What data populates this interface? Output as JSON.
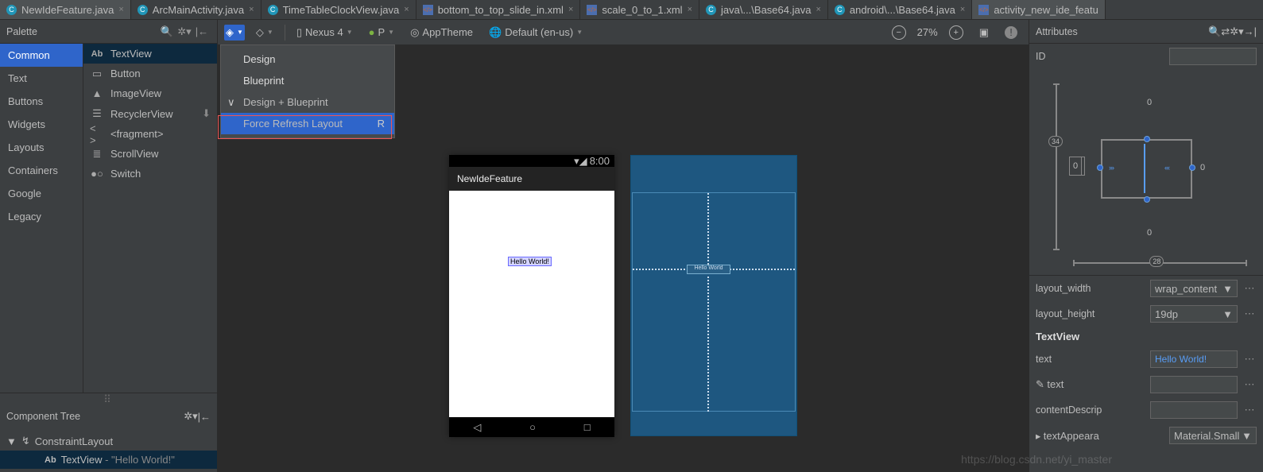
{
  "tabs": [
    {
      "label": "NewIdeFeature.java",
      "icon": "c",
      "sel": true
    },
    {
      "label": "ArcMainActivity.java",
      "icon": "c"
    },
    {
      "label": "TimeTableClockView.java",
      "icon": "c"
    },
    {
      "label": "bottom_to_top_slide_in.xml",
      "icon": "x"
    },
    {
      "label": "scale_0_to_1.xml",
      "icon": "x"
    },
    {
      "label": "java\\...\\Base64.java",
      "icon": "c"
    },
    {
      "label": "android\\...\\Base64.java",
      "icon": "c"
    },
    {
      "label": "activity_new_ide_featu",
      "icon": "x",
      "sel": true
    }
  ],
  "palette": {
    "title": "Palette",
    "categories": [
      "Common",
      "Text",
      "Buttons",
      "Widgets",
      "Layouts",
      "Containers",
      "Google",
      "Legacy"
    ],
    "items": [
      {
        "label": "TextView",
        "icon": "Ab",
        "sel": true
      },
      {
        "label": "Button",
        "icon": "▭"
      },
      {
        "label": "ImageView",
        "icon": "▲"
      },
      {
        "label": "RecyclerView",
        "icon": "≡",
        "dl": true
      },
      {
        "label": "<fragment>",
        "icon": "<>"
      },
      {
        "label": "ScrollView",
        "icon": "≣"
      },
      {
        "label": "Switch",
        "icon": "●○"
      }
    ]
  },
  "componentTree": {
    "title": "Component Tree",
    "root": "ConstraintLayout",
    "child": "TextView",
    "childText": " - \"Hello World!\""
  },
  "toolbar": {
    "device": "Nexus 4",
    "api": "P",
    "theme": "AppTheme",
    "locale": "Default (en-us)",
    "zoom": "27%"
  },
  "dropdown": {
    "items": [
      {
        "label": "Design"
      },
      {
        "label": "Blueprint"
      },
      {
        "label": "Design + Blueprint",
        "check": true
      },
      {
        "label": "Force Refresh Layout",
        "hi": true,
        "shortcut": "R"
      }
    ]
  },
  "preview": {
    "statusTime": "8:00",
    "appTitle": "NewIdeFeature",
    "hello": "Hello World!",
    "bpHello": "Hello World"
  },
  "attributes": {
    "title": "Attributes",
    "id_label": "ID",
    "id_value": "",
    "badge": "34",
    "knob": "28",
    "edge": "0",
    "inv": "0",
    "layout_width_label": "layout_width",
    "layout_width": "wrap_content",
    "layout_height_label": "layout_height",
    "layout_height": "19dp",
    "section": "TextView",
    "text_label": "text",
    "text": "Hello World!",
    "text2_label": "text",
    "text2": "",
    "cd_label": "contentDescrip",
    "cd": "",
    "ta_label": "textAppeara",
    "ta": "Material.Small"
  },
  "watermark": "https://blog.csdn.net/yi_master"
}
